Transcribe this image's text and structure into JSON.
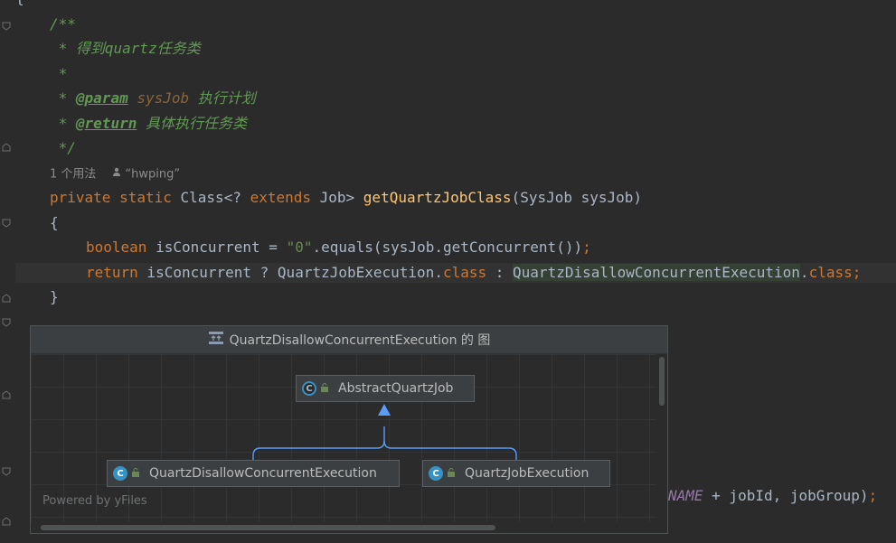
{
  "editor": {
    "top_brace": "{",
    "doc_open": "/**",
    "doc_line1": " * 得到quartz任务类",
    "doc_line2": " *",
    "doc_star": " * ",
    "param_tag": "@param",
    "param_name": " sysJob",
    "param_desc": " 执行计划",
    "return_tag": "@return",
    "return_desc": " 具体执行任务类",
    "doc_close": " */",
    "usage_hint": "1 个用法",
    "author_hint": "“hwping”",
    "sig": {
      "modifiers": "private static ",
      "type": "Class<? ",
      "extends": "extends",
      "type2": " Job> ",
      "method": "getQuartzJobClass",
      "params": "(SysJob sysJob)"
    },
    "open_brace": "{",
    "line_bool": {
      "kw": "boolean",
      "rest": " isConcurrent = ",
      "str": "\"0\"",
      "call": ".equals(sysJob.getConcurrent())",
      "semi": ";"
    },
    "line_return": {
      "kw": "return",
      "a": " isConcurrent ? QuartzJobExecution.",
      "cls1": "class",
      "b": " : ",
      "hl": "QuartzDisallowConcurrentExecution",
      "c": ".",
      "cls2": "class",
      "semi": ";"
    },
    "close_brace": "}",
    "bottom_line": {
      "const": "NAME",
      "rest": " + jobId, jobGroup)",
      "semi": ";"
    }
  },
  "popup": {
    "title": "QuartzDisallowConcurrentExecution 的 图",
    "nodes": {
      "parent": "AbstractQuartzJob",
      "child1": "QuartzDisallowConcurrentExecution",
      "child2": "QuartzJobExecution"
    },
    "class_glyph": "C",
    "powered_by": "Powered by yFiles"
  },
  "colors": {
    "background": "#2b2b2b",
    "keyword": "#cc7832",
    "method": "#ffc66d",
    "doc_comment": "#629755",
    "edge": "#589df6"
  }
}
